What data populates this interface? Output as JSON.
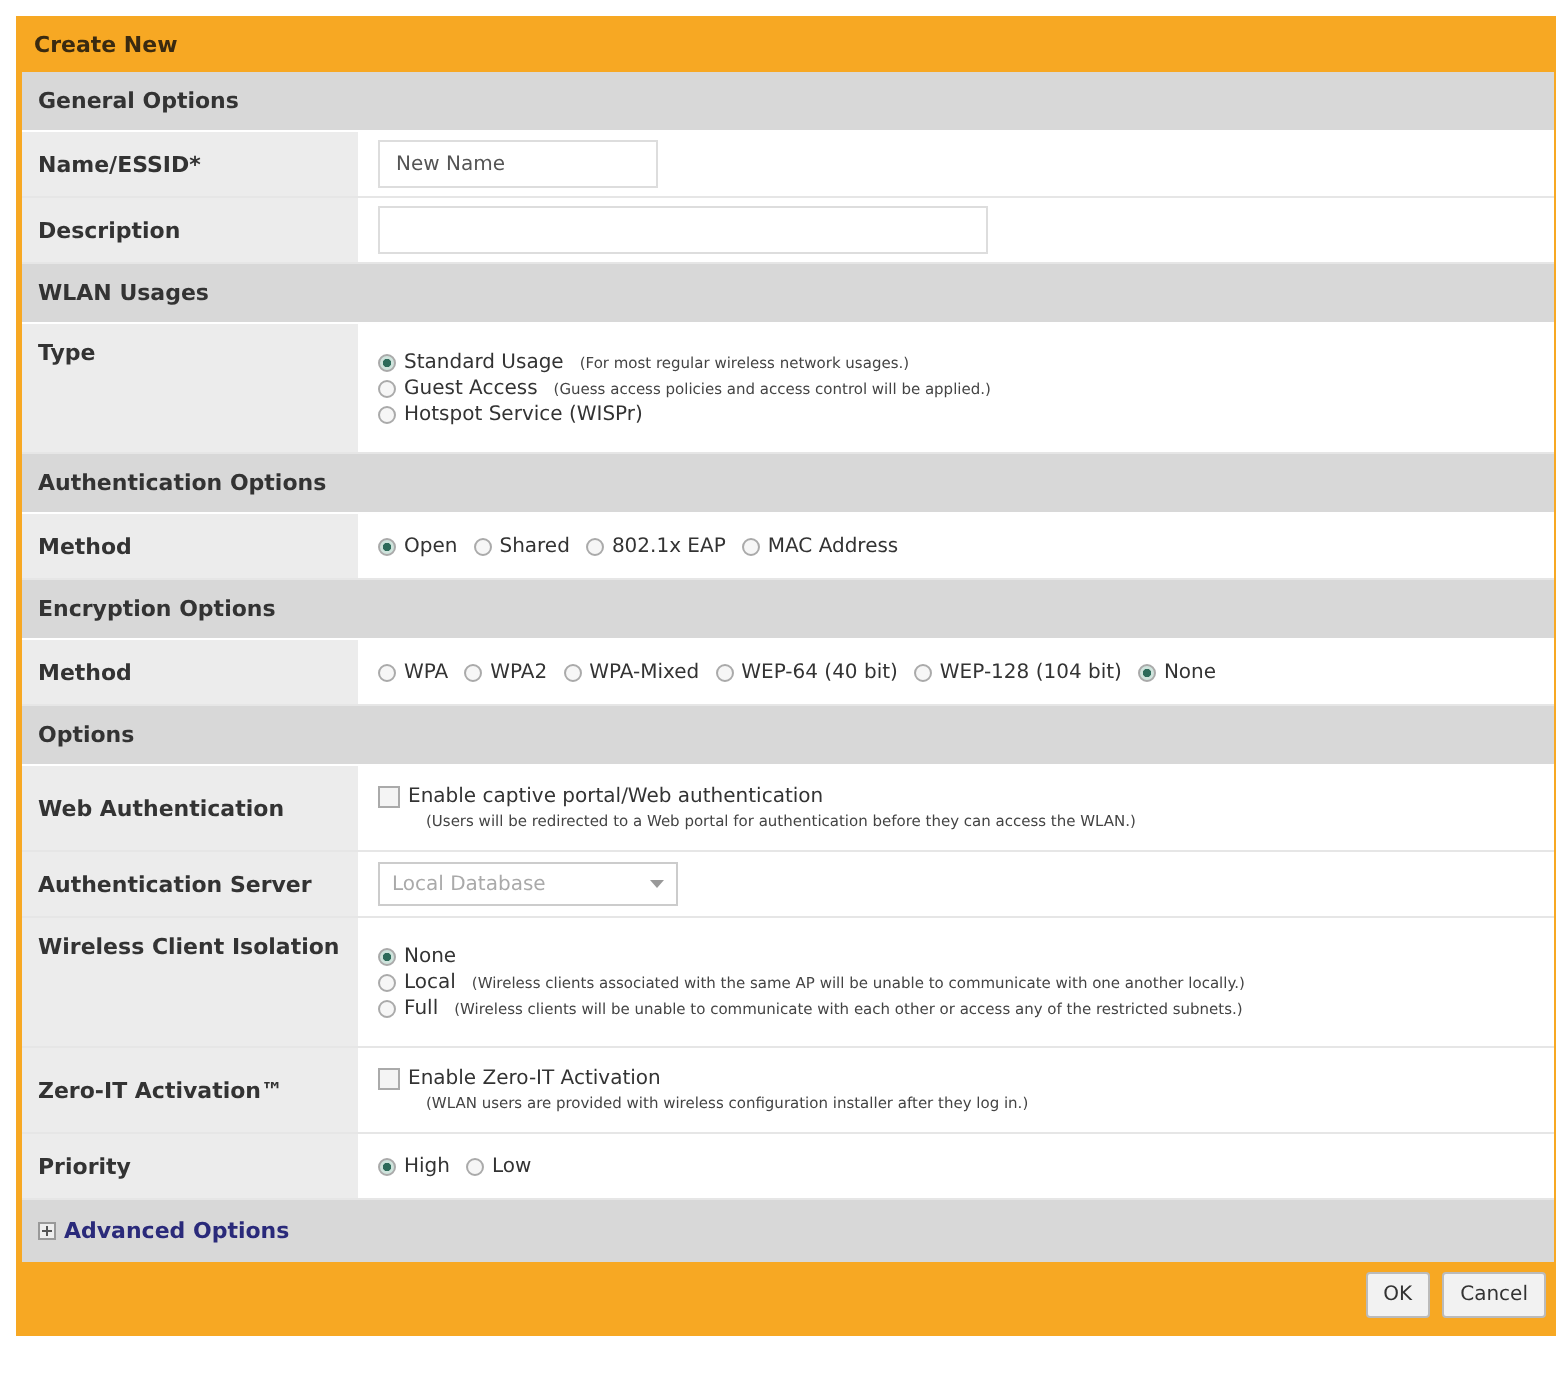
{
  "dialog": {
    "title": "Create New"
  },
  "sections": [
    {
      "title": "General Options",
      "rows": [
        {
          "kind": "text",
          "label": "Name/ESSID*",
          "value": "New Name"
        },
        {
          "kind": "wide-text",
          "label": "Description",
          "value": ""
        }
      ]
    },
    {
      "title": "WLAN Usages",
      "rows": [
        {
          "kind": "radio-list",
          "label": "Type",
          "options": [
            {
              "label": "Standard Usage",
              "note": "(For most regular wireless network usages.)",
              "selected": true
            },
            {
              "label": "Guest Access",
              "note": "(Guess access policies and access control will be applied.)",
              "selected": false
            },
            {
              "label": "Hotspot Service (WISPr)",
              "selected": false
            }
          ]
        }
      ]
    },
    {
      "title": "Authentication Options",
      "rows": [
        {
          "kind": "radio-row",
          "label": "Method",
          "options": [
            {
              "label": "Open",
              "selected": true
            },
            {
              "label": "Shared",
              "selected": false
            },
            {
              "label": "802.1x EAP",
              "selected": false
            },
            {
              "label": "MAC Address",
              "selected": false
            }
          ]
        }
      ]
    },
    {
      "title": "Encryption Options",
      "rows": [
        {
          "kind": "radio-row",
          "label": "Method",
          "options": [
            {
              "label": "WPA",
              "selected": false
            },
            {
              "label": "WPA2",
              "selected": false
            },
            {
              "label": "WPA-Mixed",
              "selected": false
            },
            {
              "label": "WEP-64 (40 bit)",
              "selected": false
            },
            {
              "label": "WEP-128 (104 bit)",
              "selected": false
            },
            {
              "label": "None",
              "selected": true
            }
          ]
        }
      ]
    },
    {
      "title": "Options",
      "rows": [
        {
          "kind": "checkbox",
          "label": "Web Authentication",
          "text": "Enable captive portal/Web authentication",
          "note": "(Users will be redirected to a Web portal for authentication before they can access the WLAN.)",
          "checked": false
        },
        {
          "kind": "select",
          "label": "Authentication Server",
          "value": "Local Database",
          "disabled": true
        },
        {
          "kind": "radio-list",
          "label": "Wireless Client Isolation",
          "options": [
            {
              "label": "None",
              "selected": true
            },
            {
              "label": "Local",
              "note": "(Wireless clients associated with the same AP will be unable to communicate with one another locally.)",
              "selected": false
            },
            {
              "label": "Full",
              "note": "(Wireless clients will be unable to communicate with each other or access any of the restricted subnets.)",
              "selected": false
            }
          ]
        },
        {
          "kind": "checkbox",
          "label": "Zero-IT Activation™",
          "text": "Enable Zero-IT Activation",
          "note": "(WLAN users are provided with wireless configuration installer after they log in.)",
          "checked": false
        },
        {
          "kind": "radio-row",
          "label": "Priority",
          "options": [
            {
              "label": "High",
              "selected": true
            },
            {
              "label": "Low",
              "selected": false
            }
          ]
        }
      ]
    }
  ],
  "advanced": {
    "label": "Advanced Options",
    "expanded": false
  },
  "buttons": [
    "OK",
    "Cancel"
  ]
}
